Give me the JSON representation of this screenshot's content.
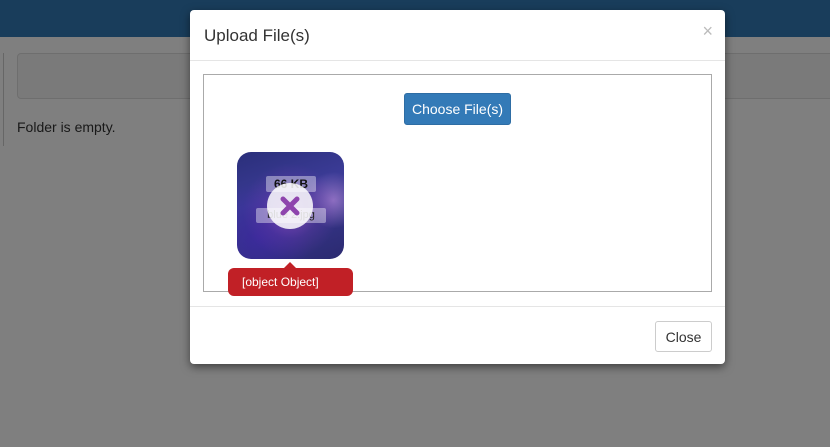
{
  "page": {
    "empty_message": "Folder is empty."
  },
  "modal": {
    "title": "Upload File(s)",
    "close_glyph": "×",
    "choose_button": "Choose File(s)",
    "footer_close_button": "Close"
  },
  "upload_item": {
    "size": "66 KB",
    "name": "blue 2.jpg",
    "error": "[object Object]",
    "remove_icon": "remove-icon"
  },
  "colors": {
    "primary": "#337ab7",
    "error": "#c12026",
    "remove_x": "#8e44ad"
  }
}
